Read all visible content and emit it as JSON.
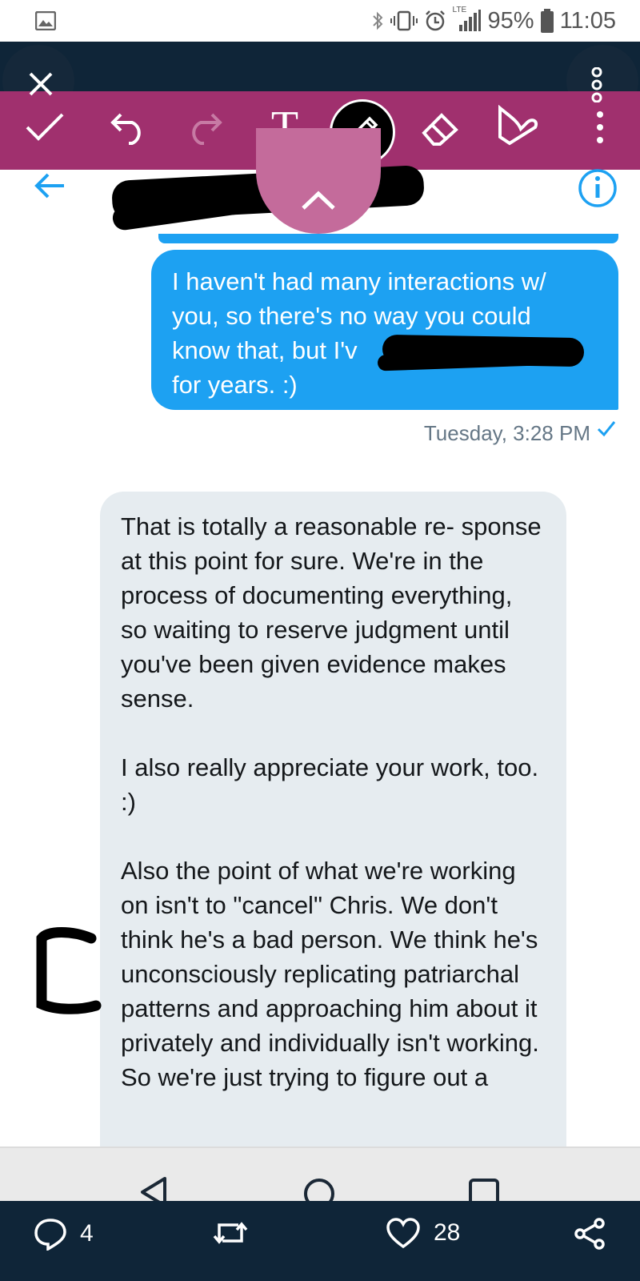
{
  "status_bar": {
    "battery": "95%",
    "time": "11:05",
    "network_label": "LTE"
  },
  "editor_toolbar": {
    "tools": [
      "check-icon",
      "undo-icon",
      "redo-icon",
      "text-tool-icon",
      "pen-icon",
      "eraser-icon",
      "highlighter-icon",
      "more-icon"
    ],
    "active_tool": "pen-icon",
    "text_tool_glyph": "T",
    "accent_color": "#a0306e"
  },
  "conversation": {
    "sent_message": "I haven't had many interactions w/ you, so there's no way you could know that, but I'v",
    "sent_message_tail": "for years. :)",
    "sent_timestamp": "Tuesday, 3:28 PM",
    "received_paragraph_1": "That is totally a reasonable re- sponse at this point for sure. We're in the process of documenting everything, so waiting to reserve judgment until you've been given evidence makes sense.",
    "received_paragraph_2": "I also really appreciate your work, too. :)",
    "received_paragraph_3": "Also the point of what we're working on isn't to \"cancel\" Chris. We don't think he's a bad person. We think he's unconsciously replicating patriarchal patterns and approaching him about it privately and individually isn't working. So we're just trying to figure out a",
    "annotation_letter": "C",
    "bubble_out_color": "#1da1f2",
    "bubble_in_color": "#e6ecf0"
  },
  "actions": {
    "replies": "4",
    "likes": "28"
  }
}
